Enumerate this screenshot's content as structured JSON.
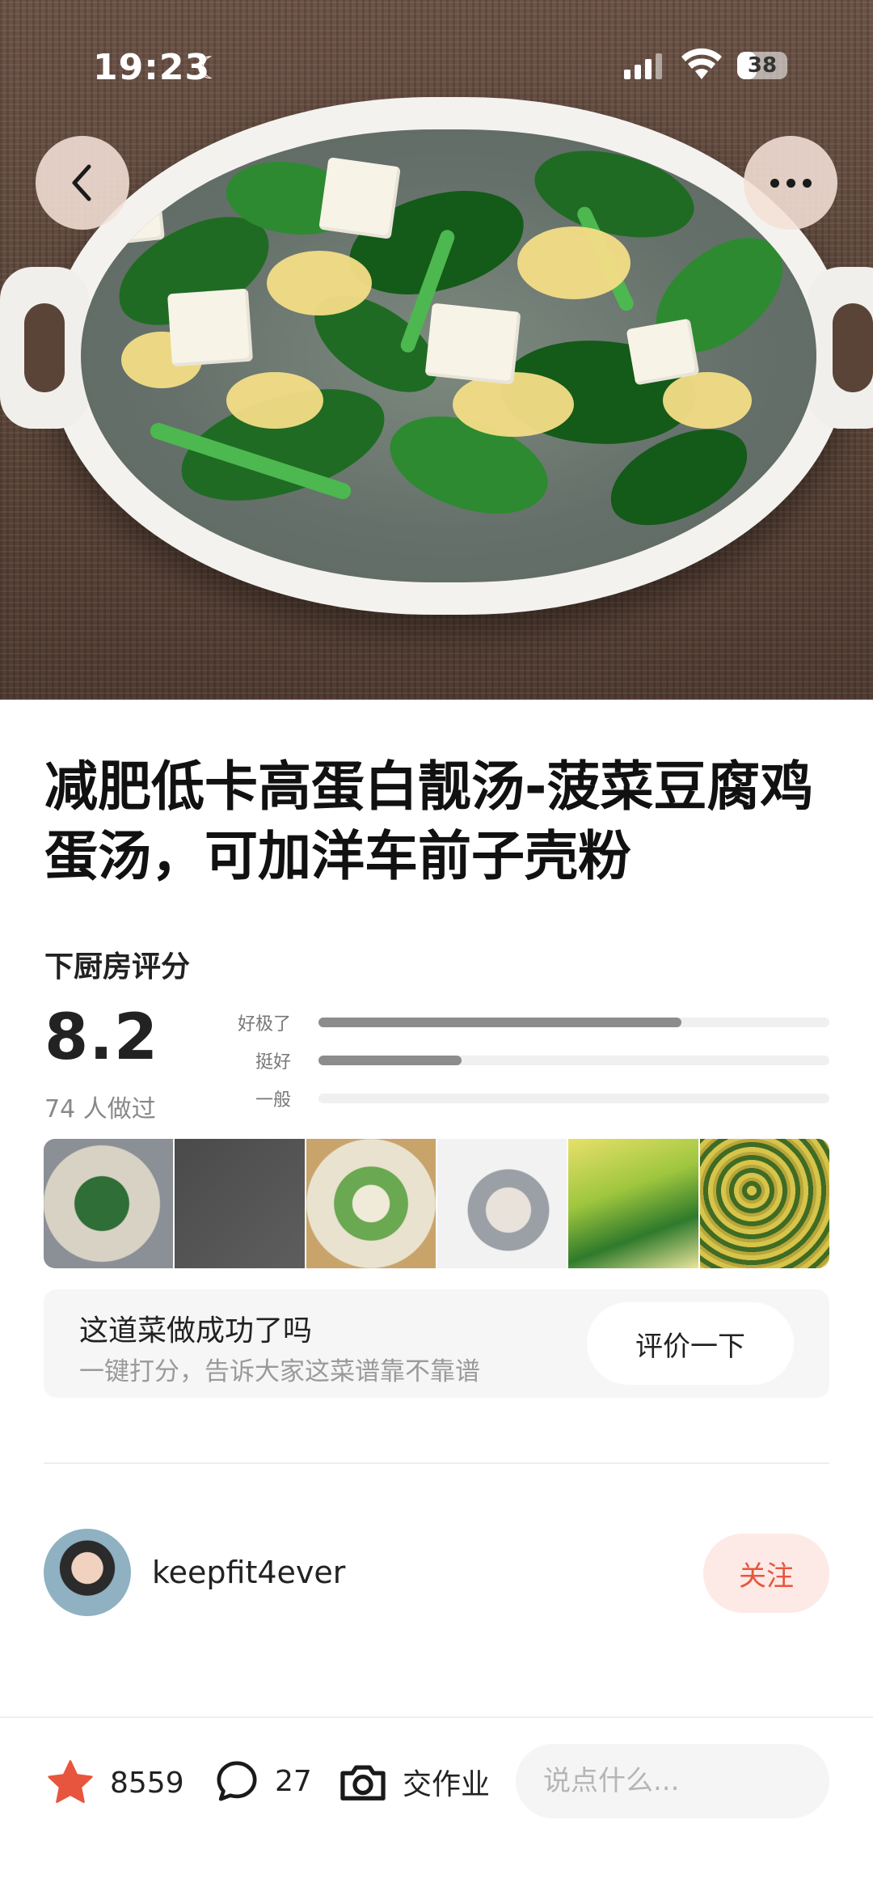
{
  "status_bar": {
    "time": "19:23",
    "battery": "38",
    "battery_level": 0.38
  },
  "recipe": {
    "title": "减肥低卡高蛋白靓汤-菠菜豆腐鸡蛋汤，可加洋车前子壳粉",
    "rating_label": "下厨房评分",
    "score": "8.2",
    "made_count": "74 人做过",
    "rating_bars": [
      {
        "label": "好极了",
        "fraction": 0.71
      },
      {
        "label": "挺好",
        "fraction": 0.28
      },
      {
        "label": "一般",
        "fraction": 0.0
      }
    ]
  },
  "review_prompt": {
    "title": "这道菜做成功了吗",
    "subtitle": "一键打分，告诉大家这菜谱靠不靠谱",
    "button": "评价一下"
  },
  "author": {
    "name": "keepfit4ever",
    "follow_label": "关注"
  },
  "bottom_bar": {
    "favorites": "8559",
    "comments": "27",
    "homework_label": "交作业",
    "comment_placeholder": "说点什么..."
  },
  "colors": {
    "accent": "#e8553e",
    "follow_bg": "#fdeae6"
  }
}
